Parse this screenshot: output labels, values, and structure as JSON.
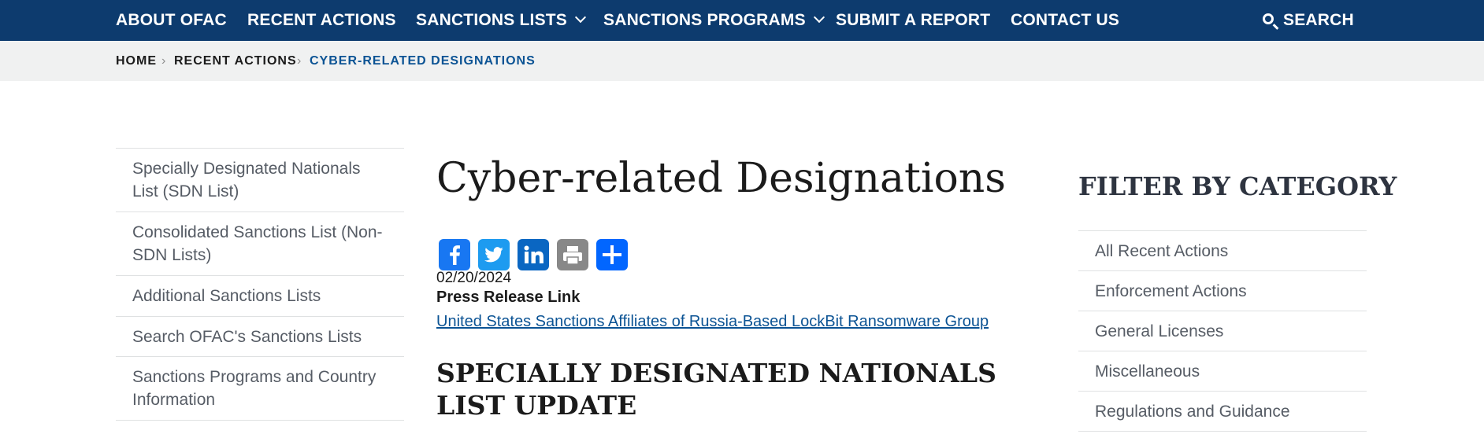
{
  "nav": {
    "items": [
      {
        "label": "ABOUT OFAC",
        "dropdown": false
      },
      {
        "label": "RECENT ACTIONS",
        "dropdown": false
      },
      {
        "label": "SANCTIONS LISTS",
        "dropdown": true
      },
      {
        "label": "SANCTIONS PROGRAMS",
        "dropdown": true
      },
      {
        "label": "SUBMIT A REPORT",
        "dropdown": false
      },
      {
        "label": "CONTACT US",
        "dropdown": false
      }
    ],
    "search_label": "SEARCH",
    "background": "#0d3b6e"
  },
  "breadcrumb": {
    "items": [
      "HOME",
      "RECENT ACTIONS",
      "CYBER-RELATED DESIGNATIONS"
    ],
    "separator": "›",
    "current_color": "#0b5394"
  },
  "sidebar": {
    "items": [
      {
        "label": "Specially Designated Nationals List (SDN List)"
      },
      {
        "label": "Consolidated Sanctions List (Non-SDN Lists)"
      },
      {
        "label": "Additional Sanctions Lists"
      },
      {
        "label": "Search OFAC's Sanctions Lists"
      },
      {
        "label": "Sanctions Programs and Country Information"
      }
    ]
  },
  "main": {
    "title": "Cyber-related Designations",
    "share_icons": [
      "facebook-icon",
      "twitter-icon",
      "linkedin-icon",
      "print-icon",
      "share-icon"
    ],
    "date": "02/20/2024",
    "press_release_label": "Press Release Link",
    "press_release_link": "United States Sanctions Affiliates of Russia-Based LockBit Ransomware Group",
    "subheading": "SPECIALLY DESIGNATED NATIONALS LIST UPDATE"
  },
  "filter": {
    "title": "FILTER BY CATEGORY",
    "items": [
      {
        "label": "All Recent Actions"
      },
      {
        "label": "Enforcement Actions"
      },
      {
        "label": "General Licenses"
      },
      {
        "label": "Miscellaneous"
      },
      {
        "label": "Regulations and Guidance"
      }
    ]
  }
}
